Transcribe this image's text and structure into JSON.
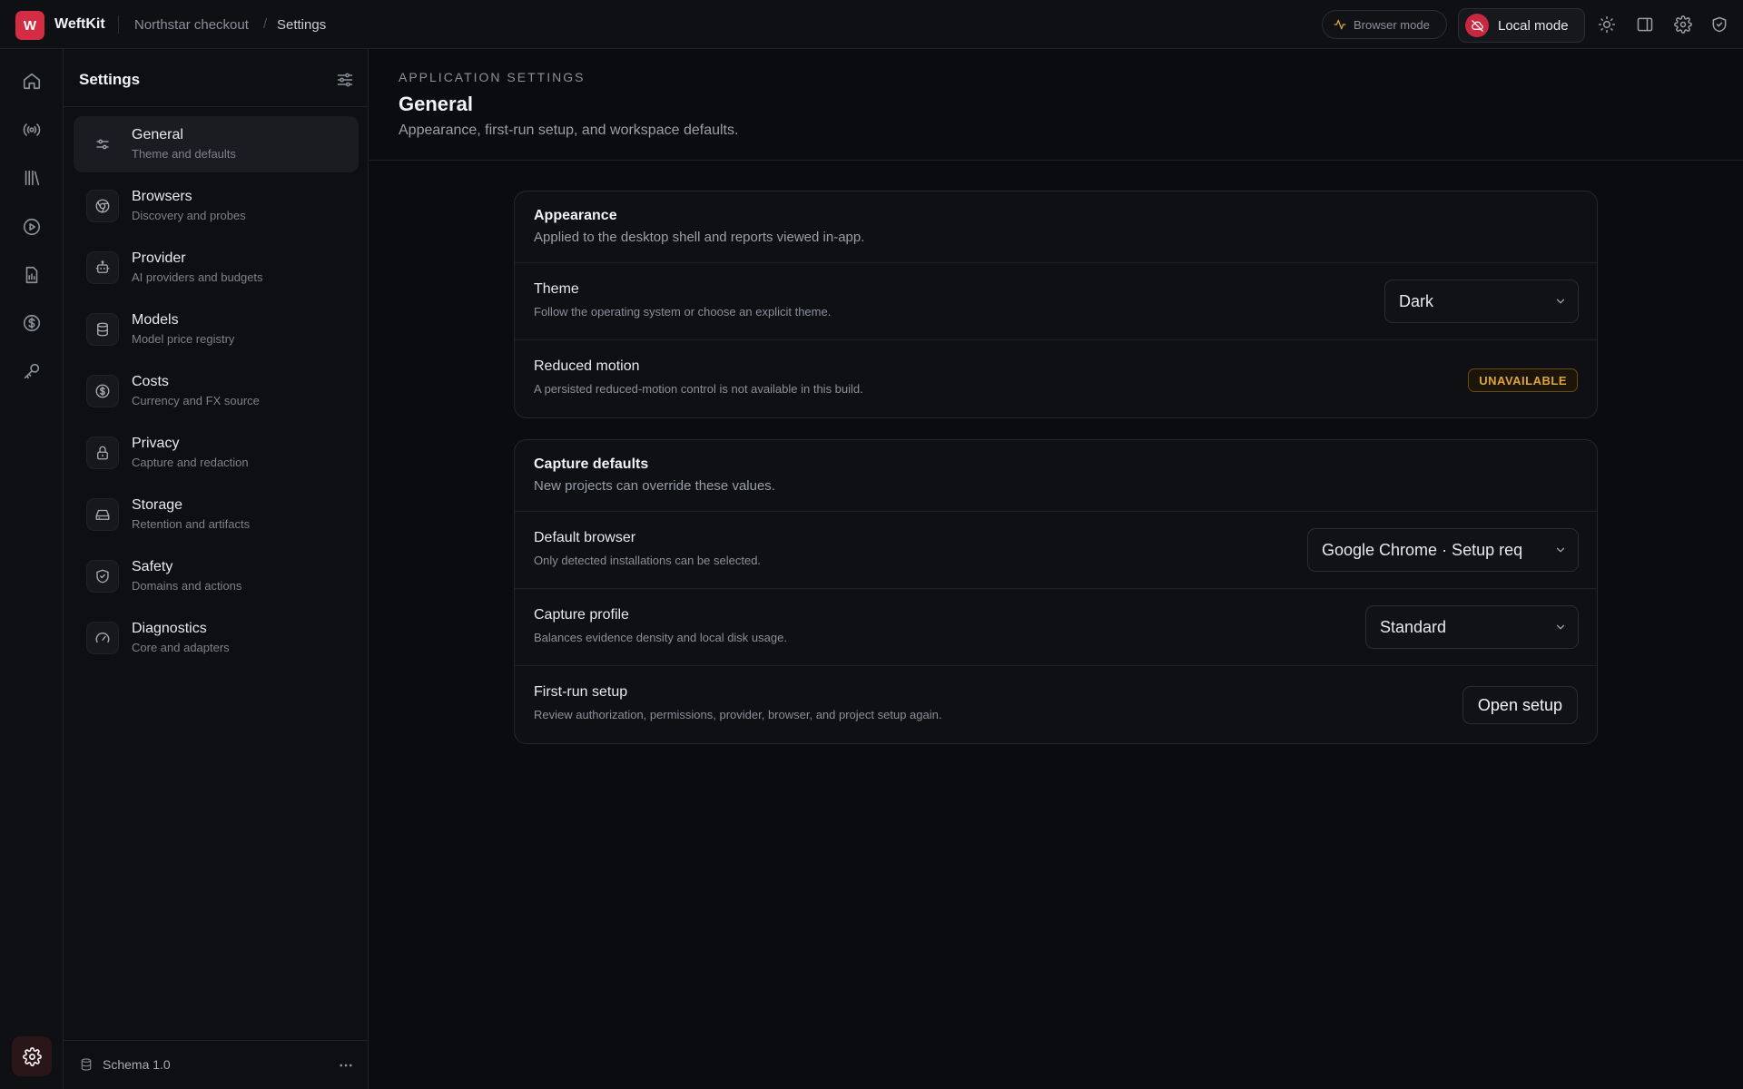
{
  "app": {
    "logo_letter": "W",
    "name": "WeftKit"
  },
  "breadcrumb": {
    "project": "Northstar checkout",
    "separator": "/",
    "current": "Settings"
  },
  "topbar": {
    "browser_mode_label": "Browser mode",
    "local_mode_label": "Local mode"
  },
  "colors": {
    "accent": "#d42c44",
    "warning": "#e0a43c",
    "background": "#0b0c0f"
  },
  "nav": {
    "title": "Settings",
    "items": [
      {
        "label": "General",
        "sub": "Theme and defaults",
        "icon": "sliders-icon",
        "active": true
      },
      {
        "label": "Browsers",
        "sub": "Discovery and probes",
        "icon": "chrome-icon"
      },
      {
        "label": "Provider",
        "sub": "AI providers and budgets",
        "icon": "bot-icon"
      },
      {
        "label": "Models",
        "sub": "Model price registry",
        "icon": "database-icon"
      },
      {
        "label": "Costs",
        "sub": "Currency and FX source",
        "icon": "dollar-circle-icon"
      },
      {
        "label": "Privacy",
        "sub": "Capture and redaction",
        "icon": "lock-icon"
      },
      {
        "label": "Storage",
        "sub": "Retention and artifacts",
        "icon": "hard-drive-icon"
      },
      {
        "label": "Safety",
        "sub": "Domains and actions",
        "icon": "shield-check-icon"
      },
      {
        "label": "Diagnostics",
        "sub": "Core and adapters",
        "icon": "gauge-icon"
      }
    ],
    "footer": {
      "schema": "Schema 1.0"
    }
  },
  "main": {
    "eyebrow": "APPLICATION SETTINGS",
    "title": "General",
    "subtitle": "Appearance, first-run setup, and workspace defaults.",
    "appearance": {
      "title": "Appearance",
      "subtitle": "Applied to the desktop shell and reports viewed in-app.",
      "theme": {
        "title": "Theme",
        "sub": "Follow the operating system or choose an explicit theme.",
        "value": "Dark"
      },
      "reduced_motion": {
        "title": "Reduced motion",
        "sub": "A persisted reduced-motion control is not available in this build.",
        "badge": "UNAVAILABLE"
      }
    },
    "capture": {
      "title": "Capture defaults",
      "subtitle": "New projects can override these values.",
      "default_browser": {
        "title": "Default browser",
        "sub": "Only detected installations can be selected.",
        "value": "Google Chrome · Setup req"
      },
      "capture_profile": {
        "title": "Capture profile",
        "sub": "Balances evidence density and local disk usage.",
        "value": "Standard"
      },
      "first_run": {
        "title": "First-run setup",
        "sub": "Review authorization, permissions, provider, browser, and project setup again.",
        "button": "Open setup"
      }
    }
  }
}
